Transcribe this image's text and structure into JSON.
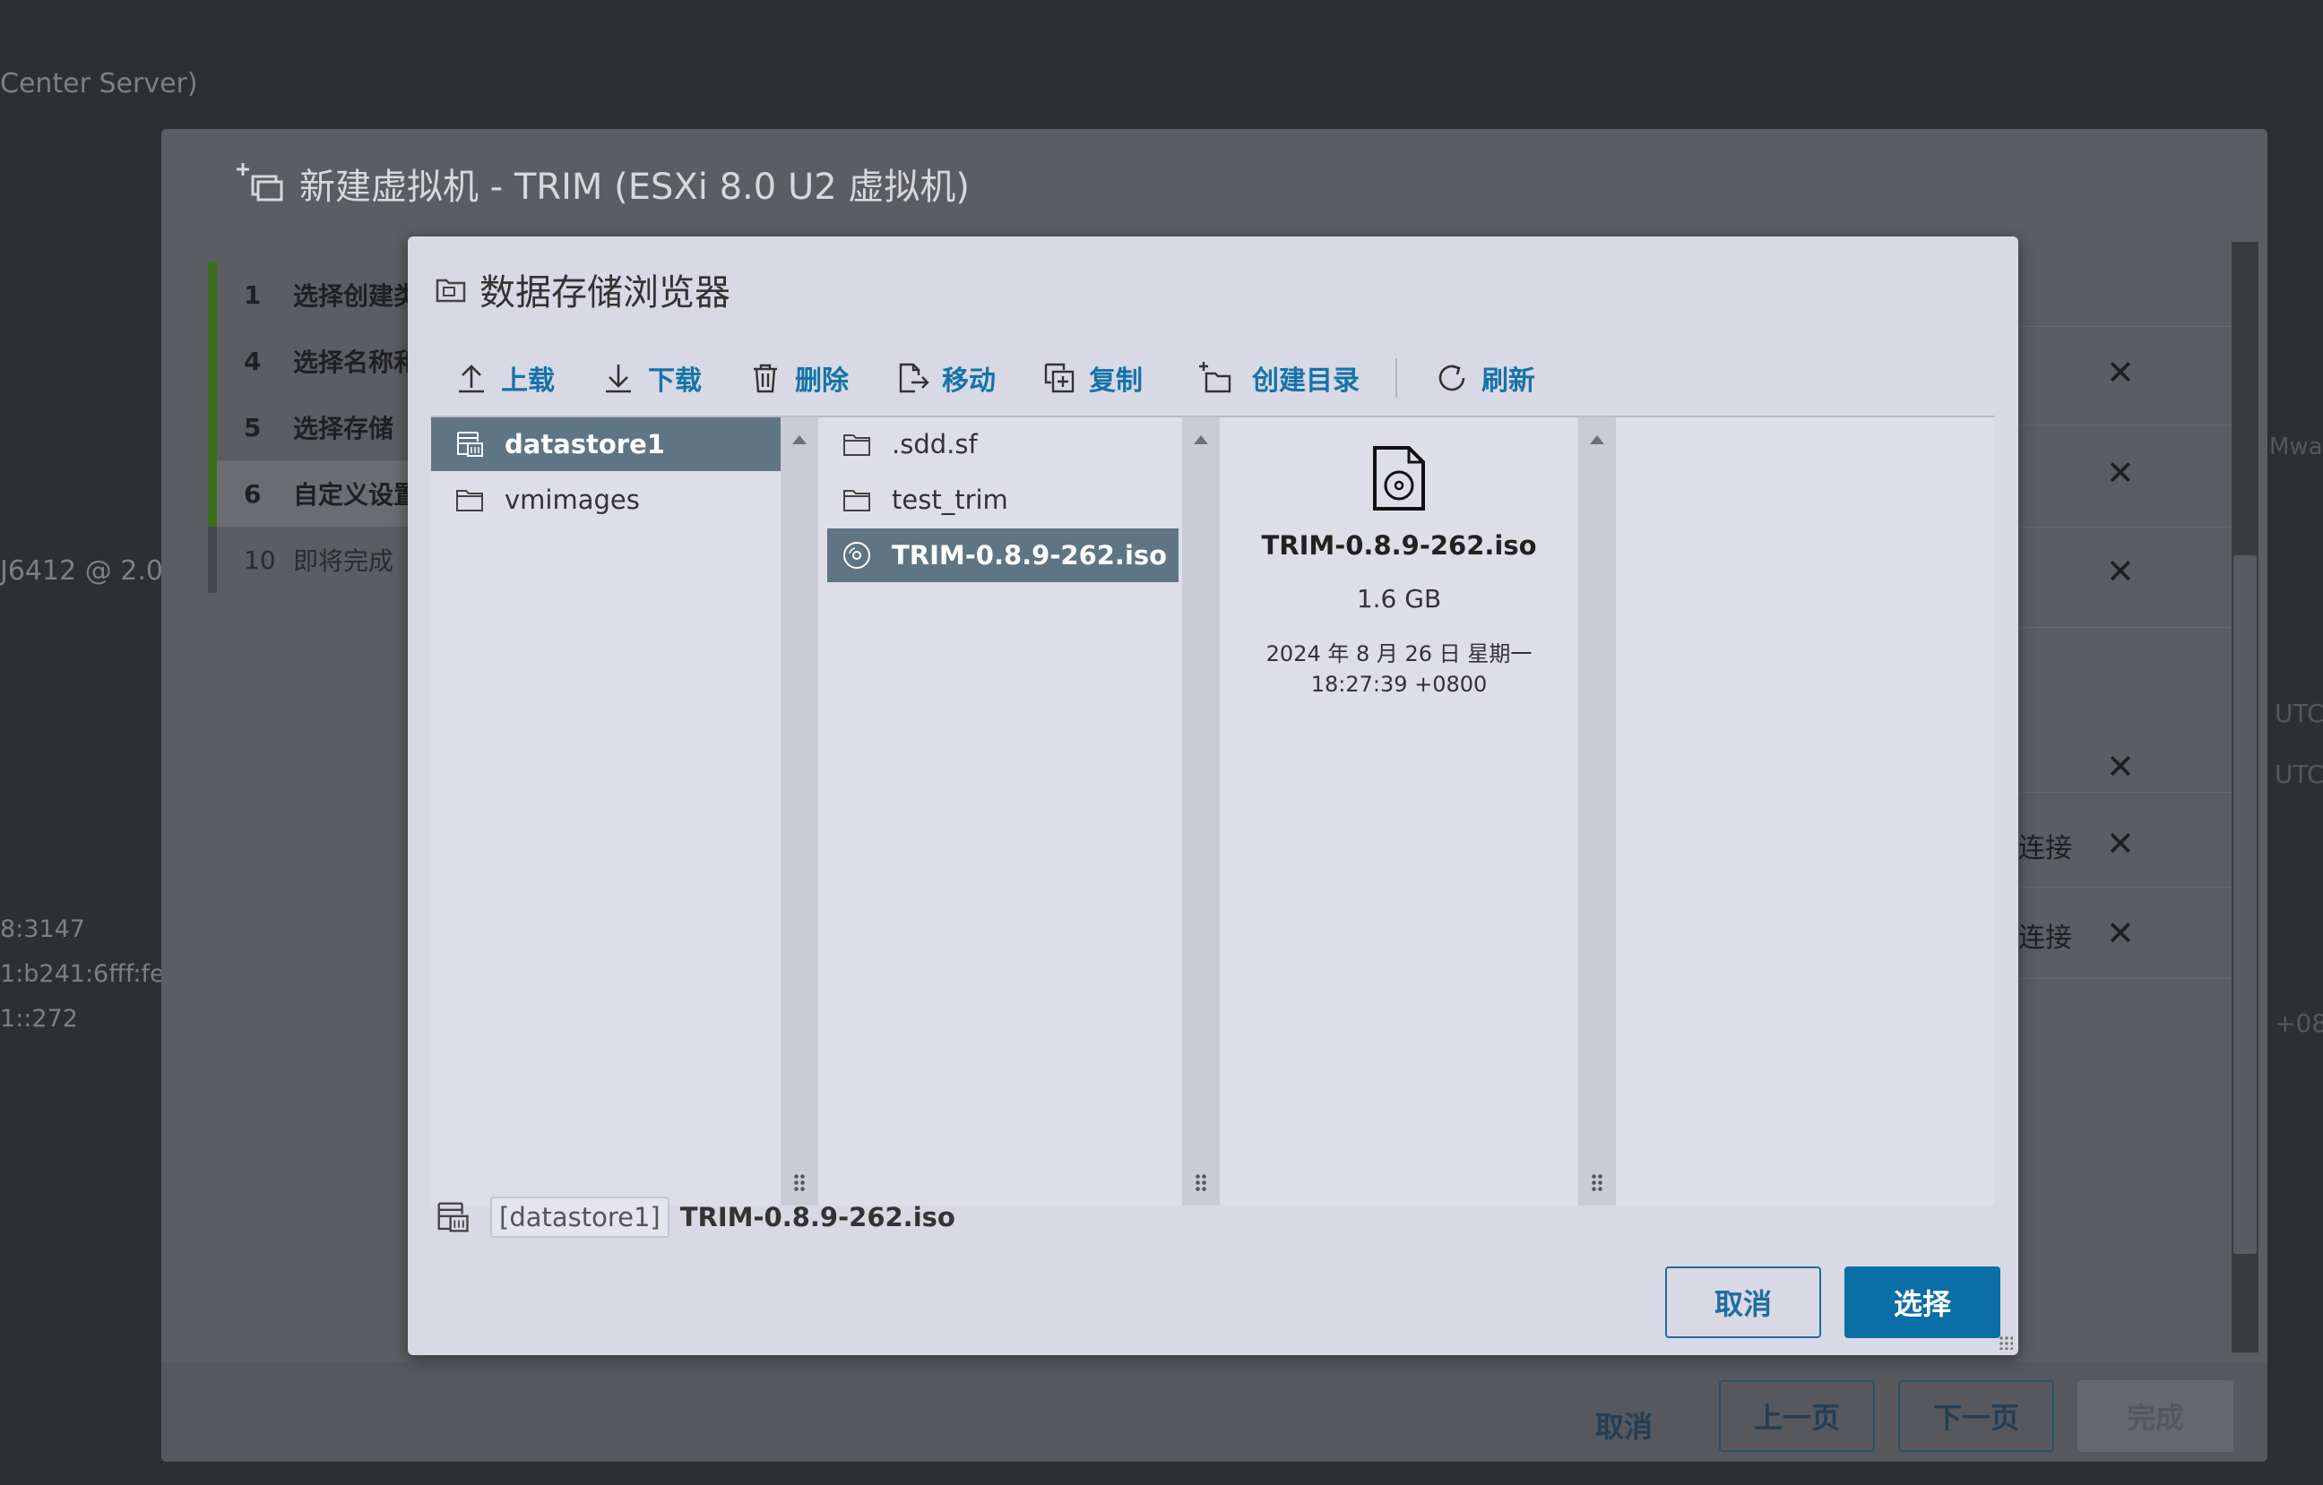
{
  "background": {
    "top_text": "Center Server)",
    "cpu_text": "J6412 @ 2.0",
    "addr1": "8:3147",
    "addr2": "1:b241:6fff:fe",
    "addr3": "1::272",
    "right1": "Mwa",
    "right_utc1": "UTC",
    "right_utc2": "UTC",
    "right_tz": "+08"
  },
  "wizard": {
    "title": "新建虚拟机 - TRIM (ESXi 8.0 U2 虚拟机)",
    "steps": [
      {
        "num": "1",
        "label": "选择创建类"
      },
      {
        "num": "4",
        "label": "选择名称和"
      },
      {
        "num": "5",
        "label": "选择存储"
      },
      {
        "num": "6",
        "label": "自定义设置"
      },
      {
        "num": "10",
        "label": "即将完成"
      }
    ],
    "right_rows": {
      "connect1": "连接",
      "connect2": "连接"
    },
    "footer": {
      "cancel": "取消",
      "prev": "上一页",
      "next": "下一页",
      "finish": "完成"
    }
  },
  "dialog": {
    "title": "数据存储浏览器",
    "toolbar": {
      "upload": "上载",
      "download": "下载",
      "delete": "删除",
      "move": "移动",
      "copy": "复制",
      "mkdir": "创建目录",
      "refresh": "刷新"
    },
    "datastores": [
      {
        "name": "datastore1",
        "icon": "datastore-icon",
        "selected": true
      },
      {
        "name": "vmimages",
        "icon": "folder-icon",
        "selected": false
      }
    ],
    "files": [
      {
        "name": ".sdd.sf",
        "icon": "folder-icon",
        "selected": false
      },
      {
        "name": "test_trim",
        "icon": "folder-icon",
        "selected": false
      },
      {
        "name": "TRIM-0.8.9-262.iso",
        "icon": "disc-icon",
        "selected": true
      }
    ],
    "preview": {
      "name": "TRIM-0.8.9-262.iso",
      "size": "1.6 GB",
      "date_line1": "2024 年 8 月 26 日 星期一",
      "date_line2": "18:27:39 +0800"
    },
    "path": {
      "datastore": "[datastore1]",
      "file": "TRIM-0.8.9-262.iso"
    },
    "buttons": {
      "cancel": "取消",
      "select": "选择"
    },
    "colors": {
      "accent": "#0b6fa7",
      "selection": "#5f7584",
      "toolbar_text": "#1673a8"
    }
  }
}
